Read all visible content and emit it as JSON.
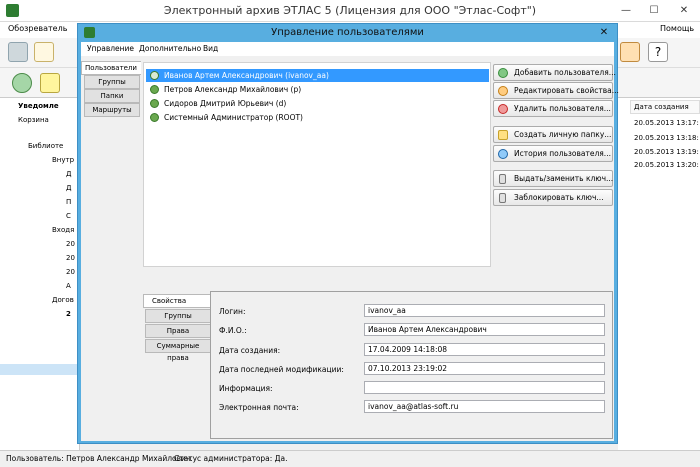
{
  "main": {
    "title": "Электронный архив ЭТЛАС 5 (Лицензия для ООО \"Этлас-Софт\")",
    "menu": {
      "browser": "Обозреватель",
      "help": "Помощь"
    },
    "left_panel": {
      "notifications": "Уведомле",
      "trash": "Корзина",
      "tree": [
        "Библиоте",
        "Внутр",
        "Д",
        "Д",
        "П",
        "С",
        "Входя",
        "20",
        "20",
        "20",
        "А",
        "Догов",
        "2",
        "",
        "",
        ""
      ]
    },
    "right_panel": {
      "column_header": "Дата создания",
      "dates": [
        "20.05.2013 13:17:",
        "20.05.2013 13:18:",
        "20.05.2013 13:19:",
        "20.05.2013 13:20:"
      ]
    },
    "status": {
      "user": "Пользователь: Петров Александр Михайлович.",
      "admin": "Статус администратора: Да."
    }
  },
  "dialog": {
    "title": "Управление пользователями",
    "close_label": "✕",
    "menu": {
      "management": "Управление",
      "extra": "Дополнительно",
      "view": "Вид"
    },
    "tabs": [
      "Пользователи",
      "Группы",
      "Папки",
      "Маршруты"
    ],
    "users": [
      "Иванов Артем Александрович  (ivanov_aa)",
      "Петров Александр Михайлович  (p)",
      "Сидоров Дмитрий Юрьевич  (d)",
      "Системный Администратор  (ROOT)"
    ],
    "actions": {
      "add": "Добавить пользователя...",
      "edit": "Редактировать свойства...",
      "delete": "Удалить пользователя...",
      "create_folder": "Создать личную папку...",
      "history": "История пользователя...",
      "issue_key": "Выдать/заменить ключ...",
      "block_key": "Заблокировать ключ..."
    },
    "props_tabs": [
      "Свойства",
      "Группы",
      "Права",
      "Суммарные права"
    ],
    "props": {
      "login_label": "Логин:",
      "login_value": "ivanov_aa",
      "fio_label": "Ф.И.О.:",
      "fio_value": "Иванов Артем Александрович",
      "created_label": "Дата создания:",
      "created_value": "17.04.2009 14:18:08",
      "modified_label": "Дата последней модификации:",
      "modified_value": "07.10.2013 23:19:02",
      "info_label": "Информация:",
      "info_value": "",
      "email_label": "Электронная почта:",
      "email_value": "ivanov_aa@atlas-soft.ru"
    }
  },
  "colors": {
    "dialog_frame": "#58aee0",
    "selection": "#3399ff"
  }
}
